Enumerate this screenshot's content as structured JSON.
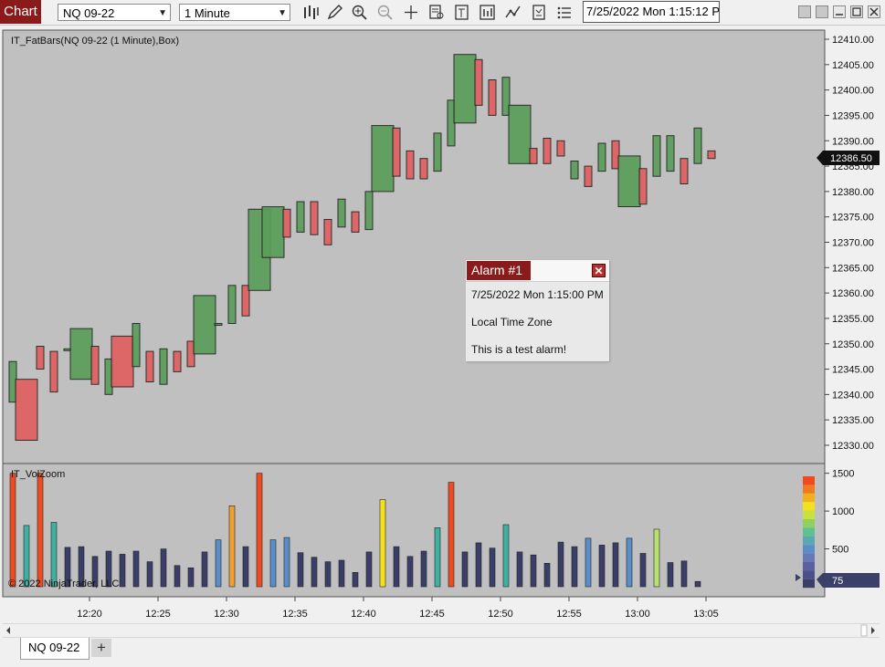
{
  "toolbar": {
    "chart_tab_label": "Chart",
    "instrument": "NQ 09-22",
    "interval": "1 Minute",
    "datetime": "7/25/2022 Mon 1:15:12 PM"
  },
  "chart": {
    "indicator_label": "IT_FatBars(NQ 09-22 (1 Minute),Box)",
    "price_ticks": [
      "12410.00",
      "12405.00",
      "12400.00",
      "12395.00",
      "12390.00",
      "12385.00",
      "12380.00",
      "12375.00",
      "12370.00",
      "12365.00",
      "12360.00",
      "12355.00",
      "12350.00",
      "12345.00",
      "12340.00",
      "12335.00",
      "12330.00"
    ],
    "last_price": "12386.50",
    "volume_label": "IT_VolZoom",
    "volume_ticks": [
      "1500",
      "1000",
      "500"
    ],
    "volume_marker": "75",
    "copyright": "© 2022 NinjaTrader, LLC",
    "time_ticks": [
      "12:20",
      "12:25",
      "12:30",
      "12:35",
      "12:40",
      "12:45",
      "12:50",
      "12:55",
      "13:00",
      "13:05"
    ],
    "colors": {
      "up": "#5a9e5a",
      "down": "#e06060",
      "background": "#c0c0c0"
    }
  },
  "alarm": {
    "title": "Alarm #1",
    "close_glyph": "✕",
    "time": "7/25/2022 Mon 1:15:00 PM",
    "zone": "Local Time Zone",
    "message": "This is a test alarm!"
  },
  "tabs": {
    "instrument_tab": "NQ 09-22",
    "add_glyph": "+"
  },
  "chart_data": {
    "type": "candlestick",
    "price_ylim": [
      12327.5,
      12412.5
    ],
    "candles": [
      {
        "time": "12:15",
        "o": 12338.5,
        "h": 12346.5,
        "l": 12338.5,
        "c": 12346.5
      },
      {
        "time": "12:16",
        "o": 12343.0,
        "h": 12343.0,
        "l": 12331.0,
        "c": 12331.0
      },
      {
        "time": "12:17",
        "o": 12349.5,
        "h": 12349.5,
        "l": 12345.0,
        "c": 12345.0
      },
      {
        "time": "12:17",
        "o": 12348.5,
        "h": 12348.5,
        "l": 12340.5,
        "c": 12340.5
      },
      {
        "time": "12:18",
        "o": 12349.0,
        "h": 12350.0,
        "l": 12341.5,
        "c": 12349.0
      },
      {
        "time": "12:19",
        "o": 12343.0,
        "h": 12353.0,
        "l": 12343.0,
        "c": 12353.0
      },
      {
        "time": "12:21",
        "o": 12349.5,
        "h": 12349.5,
        "l": 12342.0,
        "c": 12342.0
      },
      {
        "time": "12:22",
        "o": 12340.0,
        "h": 12347.0,
        "l": 12340.0,
        "c": 12347.0
      },
      {
        "time": "12:23",
        "o": 12351.5,
        "h": 12351.5,
        "l": 12341.5,
        "c": 12341.5
      },
      {
        "time": "12:24",
        "o": 12345.5,
        "h": 12354.0,
        "l": 12345.5,
        "c": 12354.0
      },
      {
        "time": "12:25",
        "o": 12348.5,
        "h": 12348.5,
        "l": 12342.5,
        "c": 12342.5
      },
      {
        "time": "12:26",
        "o": 12342.0,
        "h": 12349.0,
        "l": 12342.0,
        "c": 12349.0
      },
      {
        "time": "12:27",
        "o": 12348.5,
        "h": 12348.5,
        "l": 12344.5,
        "c": 12344.5
      },
      {
        "time": "12:28",
        "o": 12350.5,
        "h": 12350.5,
        "l": 12345.5,
        "c": 12345.5
      },
      {
        "time": "12:29",
        "o": 12348.0,
        "h": 12359.5,
        "l": 12348.0,
        "c": 12359.5
      },
      {
        "time": "12:30",
        "o": 12354.0,
        "h": 12361.5,
        "l": 12348.0,
        "c": 12354.0
      },
      {
        "time": "12:31",
        "o": 12354.0,
        "h": 12361.5,
        "l": 12354.0,
        "c": 12361.5
      },
      {
        "time": "12:32",
        "o": 12361.5,
        "h": 12361.5,
        "l": 12355.5,
        "c": 12355.5
      },
      {
        "time": "12:33",
        "o": 12360.5,
        "h": 12376.5,
        "l": 12360.5,
        "c": 12376.5
      },
      {
        "time": "12:34",
        "o": 12367.0,
        "h": 12377.0,
        "l": 12367.0,
        "c": 12377.0
      },
      {
        "time": "12:36",
        "o": 12376.5,
        "h": 12376.5,
        "l": 12371.0,
        "c": 12371.0
      },
      {
        "time": "12:37",
        "o": 12372.0,
        "h": 12372.0,
        "l": 12375.0,
        "c": 12378.0
      },
      {
        "time": "12:38",
        "o": 12378.0,
        "h": 12378.0,
        "l": 12371.5,
        "c": 12371.5
      },
      {
        "time": "12:39",
        "o": 12374.5,
        "h": 12374.5,
        "l": 12369.5,
        "c": 12369.5
      },
      {
        "time": "12:40",
        "o": 12373.0,
        "h": 12378.5,
        "l": 12373.0,
        "c": 12378.5
      },
      {
        "time": "12:41",
        "o": 12376.0,
        "h": 12376.0,
        "l": 12372.0,
        "c": 12372.0
      },
      {
        "time": "12:42",
        "o": 12372.5,
        "h": 12380.0,
        "l": 12372.5,
        "c": 12380.0
      },
      {
        "time": "12:43",
        "o": 12380.0,
        "h": 12393.0,
        "l": 12380.0,
        "c": 12393.0
      },
      {
        "time": "12:44",
        "o": 12392.5,
        "h": 12392.5,
        "l": 12383.0,
        "c": 12383.0
      },
      {
        "time": "12:45",
        "o": 12388.0,
        "h": 12388.0,
        "l": 12382.5,
        "c": 12382.5
      },
      {
        "time": "12:46",
        "o": 12386.5,
        "h": 12386.5,
        "l": 12382.5,
        "c": 12382.5
      },
      {
        "time": "12:47",
        "o": 12384.0,
        "h": 12391.5,
        "l": 12384.0,
        "c": 12391.5
      },
      {
        "time": "12:48",
        "o": 12389.0,
        "h": 12398.0,
        "l": 12389.0,
        "c": 12398.0
      },
      {
        "time": "12:49",
        "o": 12393.5,
        "h": 12407.0,
        "l": 12393.5,
        "c": 12407.0
      },
      {
        "time": "12:50",
        "o": 12406.0,
        "h": 12406.0,
        "l": 12397.0,
        "c": 12397.0
      },
      {
        "time": "12:51",
        "o": 12402.0,
        "h": 12402.0,
        "l": 12395.0,
        "c": 12395.0
      },
      {
        "time": "12:52",
        "o": 12395.0,
        "h": 12402.5,
        "l": 12395.0,
        "c": 12402.5
      },
      {
        "time": "12:53",
        "o": 12385.5,
        "h": 12397.0,
        "l": 12385.5,
        "c": 12397.0
      },
      {
        "time": "12:54",
        "o": 12388.5,
        "h": 12388.5,
        "l": 12385.5,
        "c": 12385.5
      },
      {
        "time": "12:55",
        "o": 12390.5,
        "h": 12390.5,
        "l": 12385.5,
        "c": 12385.5
      },
      {
        "time": "12:56",
        "o": 12390.0,
        "h": 12390.0,
        "l": 12387.0,
        "c": 12387.0
      },
      {
        "time": "12:57",
        "o": 12382.5,
        "h": 12386.0,
        "l": 12382.5,
        "c": 12386.0
      },
      {
        "time": "12:58",
        "o": 12385.0,
        "h": 12385.0,
        "l": 12381.0,
        "c": 12381.0
      },
      {
        "time": "12:59",
        "o": 12384.0,
        "h": 12389.5,
        "l": 12384.0,
        "c": 12389.5
      },
      {
        "time": "13:00",
        "o": 12390.0,
        "h": 12390.0,
        "l": 12384.5,
        "c": 12384.5
      },
      {
        "time": "13:01",
        "o": 12377.0,
        "h": 12387.0,
        "l": 12377.0,
        "c": 12387.0
      },
      {
        "time": "13:02",
        "o": 12384.5,
        "h": 12384.5,
        "l": 12377.5,
        "c": 12377.5
      },
      {
        "time": "13:03",
        "o": 12383.0,
        "h": 12391.0,
        "l": 12383.0,
        "c": 12391.0
      },
      {
        "time": "13:04",
        "o": 12384.0,
        "h": 12391.0,
        "l": 12384.0,
        "c": 12391.0
      },
      {
        "time": "13:05",
        "o": 12386.5,
        "h": 12386.5,
        "l": 12381.5,
        "c": 12381.5
      },
      {
        "time": "13:06",
        "o": 12385.5,
        "h": 12392.5,
        "l": 12385.5,
        "c": 12392.5
      },
      {
        "time": "13:07",
        "o": 12388.0,
        "h": 12388.0,
        "l": 12386.5,
        "c": 12386.5
      }
    ],
    "volume_ylim": [
      0,
      1520
    ],
    "volume": [
      1500,
      810,
      1500,
      850,
      520,
      530,
      400,
      470,
      430,
      470,
      330,
      500,
      280,
      250,
      460,
      620,
      1070,
      530,
      1500,
      620,
      650,
      450,
      390,
      330,
      350,
      190,
      460,
      1150,
      530,
      400,
      470,
      780,
      1380,
      460,
      580,
      510,
      820,
      460,
      420,
      310,
      590,
      530,
      640,
      550,
      580,
      640,
      440,
      760,
      320,
      340,
      70
    ]
  }
}
